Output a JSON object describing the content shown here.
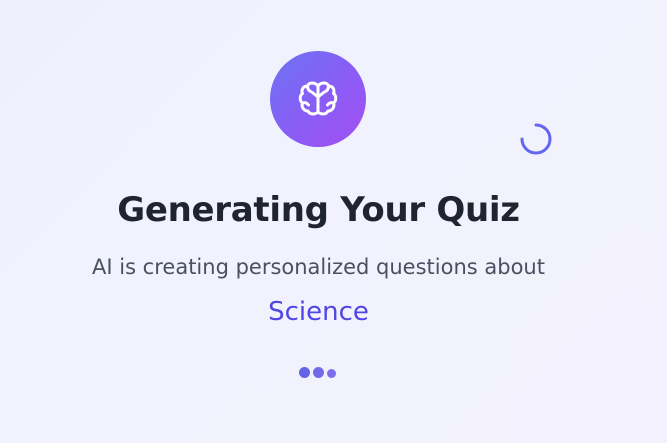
{
  "loader": {
    "icon": "brain-icon",
    "spinner_icon": "loading-spinner-icon",
    "title": "Generating Your Quiz",
    "subtitle": "AI is creating personalized questions about",
    "topic": "Science",
    "progress_indicator": "bouncing-dots"
  },
  "colors": {
    "icon_gradient_start": "#6b74f2",
    "icon_gradient_end": "#a24ff0",
    "accent": "#4f46e5",
    "title": "#1f2430",
    "subtitle": "#4b5060",
    "dots": "#6664e6",
    "spinner": "#6366f1"
  }
}
